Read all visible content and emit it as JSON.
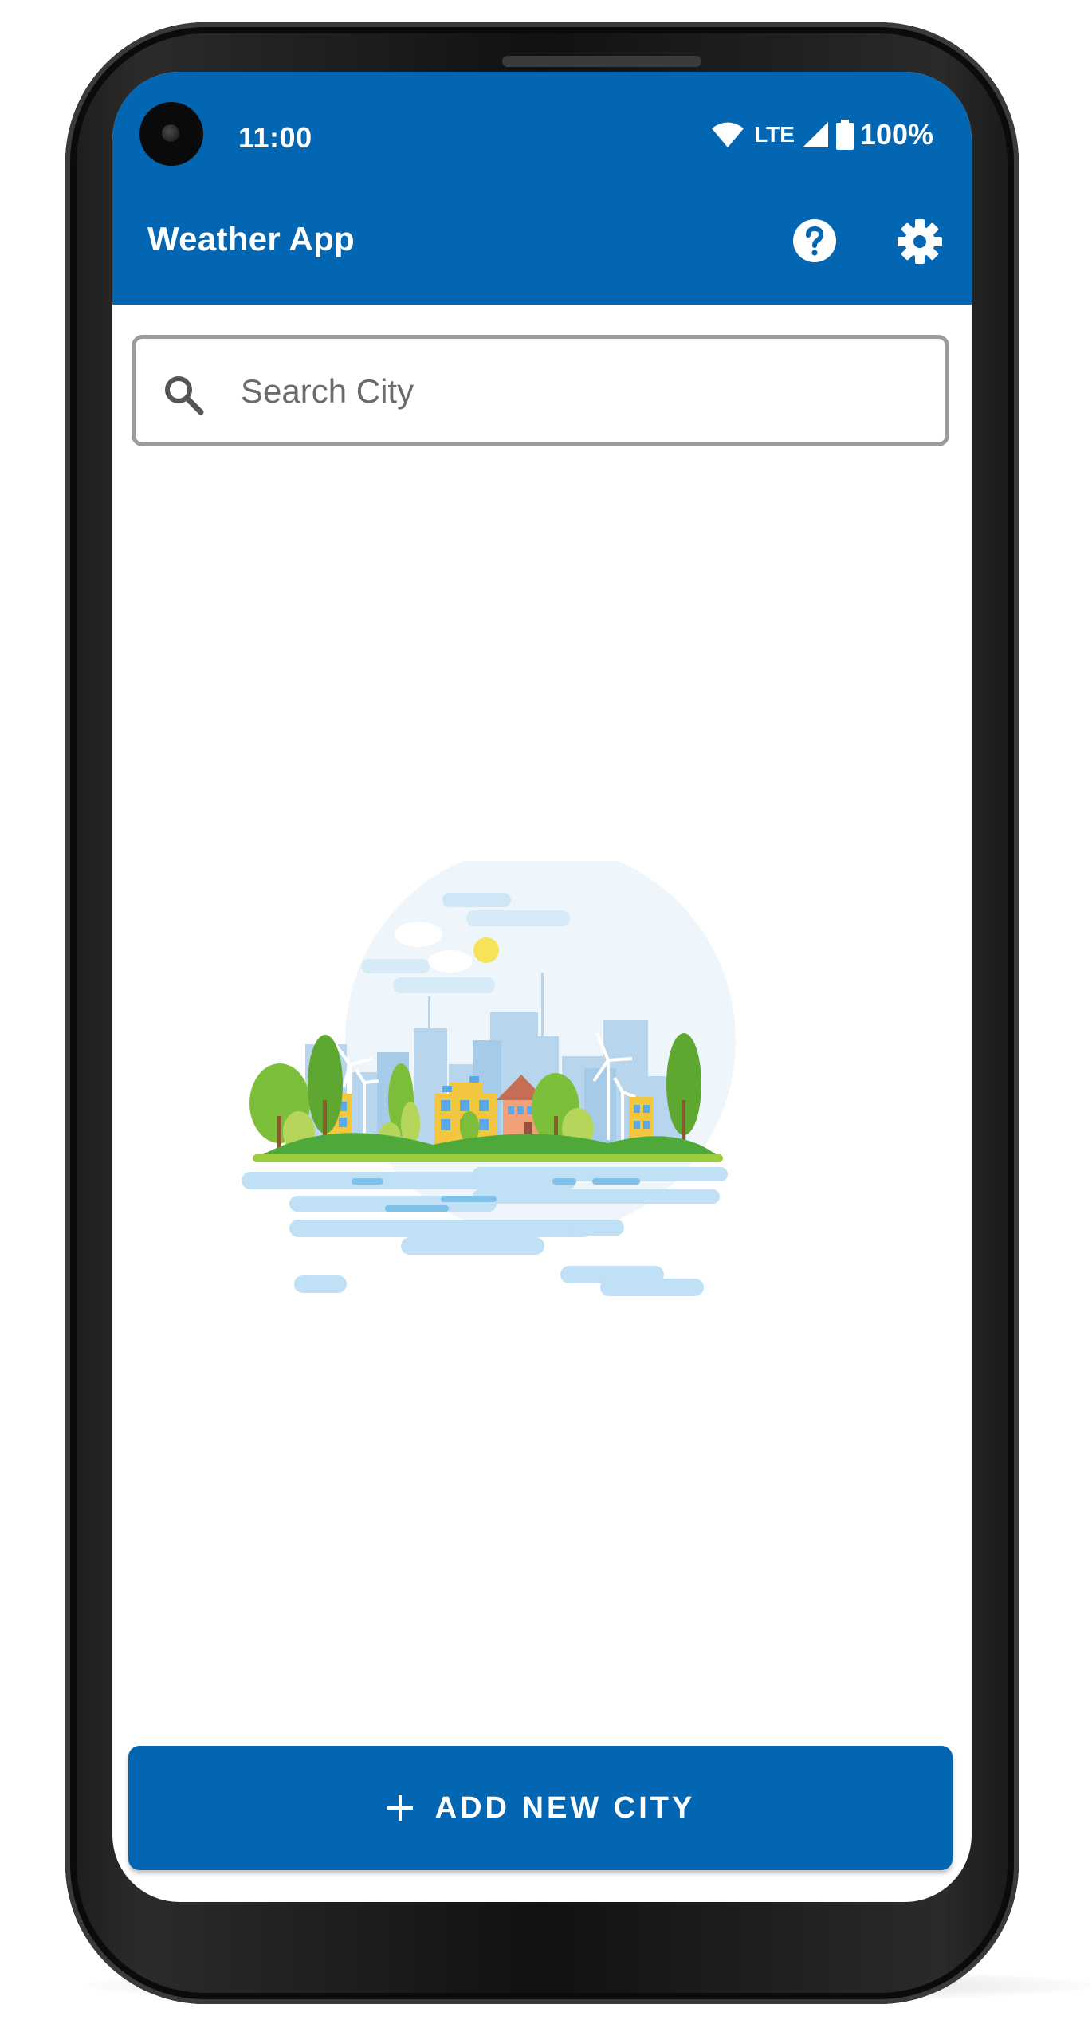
{
  "status_bar": {
    "time": "11:00",
    "network": "LTE",
    "battery": "100%",
    "icons": [
      "wifi-icon",
      "cellular-signal-icon",
      "battery-icon"
    ]
  },
  "app_bar": {
    "title": "Weather App",
    "actions": [
      "help-icon",
      "settings-icon"
    ]
  },
  "search": {
    "placeholder": "Search City",
    "value": ""
  },
  "add_button": {
    "icon": "plus-icon",
    "label": "ADD NEW CITY"
  },
  "colors": {
    "primary": "#0366b3",
    "search_border": "#9b9b9b",
    "background": "#ffffff"
  }
}
